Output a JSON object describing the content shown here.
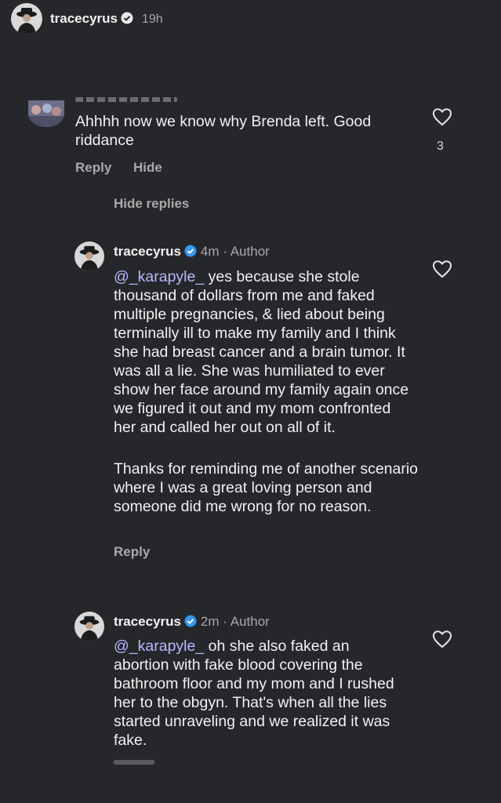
{
  "header": {
    "username": "tracecyrus",
    "time": "19h"
  },
  "top_comment": {
    "text": "Ahhhh now we know why Brenda left. Good riddance",
    "likes": "3",
    "reply_label": "Reply",
    "hide_label": "Hide",
    "hide_replies_label": "Hide replies"
  },
  "replies": [
    {
      "username": "tracecyrus",
      "time": "4m",
      "author_label": "Author",
      "mention": "@_karapyle_",
      "paragraph1": " yes because she stole thousand of dollars from me and faked multiple pregnancies, & lied about being terminally ill  to make my family and I think she had breast cancer and a brain tumor. It was all a lie. She was humiliated to ever show her face around my family again once we figured it out and my mom confronted her and called her out on all of it.",
      "paragraph2": "Thanks for reminding me of another scenario where I was a great loving person and someone did me wrong for no reason.",
      "reply_label": "Reply"
    },
    {
      "username": "tracecyrus",
      "time": "2m",
      "author_label": "Author",
      "mention": "@_karapyle_",
      "paragraph1": " oh she also faked an abortion with fake blood covering the bathroom floor and my mom and I rushed her to the obgyn. That's when all the lies started unraveling and we realized it was fake."
    }
  ],
  "colors": {
    "background": "#25272b",
    "verified": "#3797f0",
    "mention": "#b8b8ff"
  }
}
